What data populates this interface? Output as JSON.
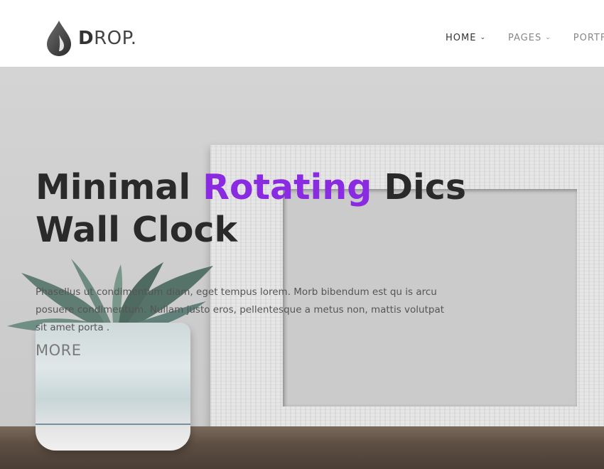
{
  "brand": {
    "logo_bold": "D",
    "logo_rest": "ROP.",
    "icon": "drop-icon"
  },
  "nav": {
    "items": [
      {
        "label": "HOME",
        "active": true
      },
      {
        "label": "PAGES",
        "active": false
      },
      {
        "label": "PORTFO",
        "active": false
      }
    ]
  },
  "hero": {
    "title_part1": "Minimal ",
    "title_accent": "Rotating",
    "title_part2": " Dics Wall Clock",
    "description": "Phasellus ut condimentum diam, eget tempus lorem. Morb bibendum est qu is arcu posuere condimentum. Nullam justo eros, pellentesque a metus non, mattis volutpat sit amet porta .",
    "cta_label": "MORE"
  },
  "colors": {
    "accent": "#8a2be2",
    "heading": "#2a2a2a",
    "nav_active": "#333333",
    "nav_inactive": "#888888"
  }
}
